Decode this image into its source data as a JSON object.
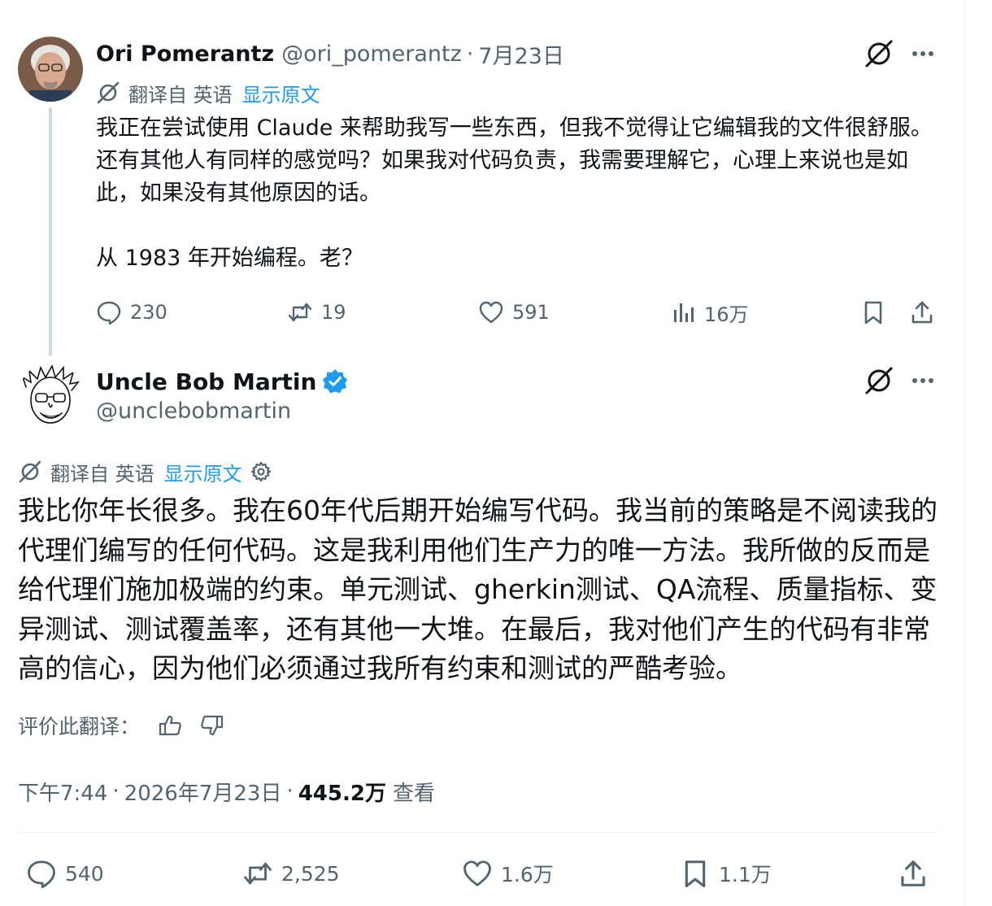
{
  "reply": {
    "author_name": "Ori Pomerantz",
    "handle": "@ori_pomerantz",
    "separator": "·",
    "date": "7月23日",
    "translation": {
      "label": "翻译自 英语",
      "show_original": "显示原文"
    },
    "text": "我正在尝试使用 Claude 来帮助我写一些东西，但我不觉得让它编辑我的文件很舒服。还有其他人有同样的感觉吗？如果我对代码负责，我需要理解它，心理上来说也是如此，如果没有其他原因的话。\n\n从 1983 年开始编程。老？",
    "stats": {
      "replies": "230",
      "reposts": "19",
      "likes": "591",
      "views": "16万"
    }
  },
  "main": {
    "author_name": "Uncle Bob Martin",
    "handle": "@unclebobmartin",
    "translation": {
      "label": "翻译自 英语",
      "show_original": "显示原文"
    },
    "text": "我比你年长很多。我在60年代后期开始编写代码。我当前的策略是不阅读我的代理们编写的任何代码。这是我利用他们生产力的唯一方法。我所做的反而是给代理们施加极端的约束。单元测试、gherkin测试、QA流程、质量指标、变异测试、测试覆盖率，还有其他一大堆。在最后，我对他们产生的代码有非常高的信心，因为他们必须通过我所有约束和测试的严酷考验。",
    "rate_label": "评价此翻译：",
    "time": "下午7:44",
    "separator": "·",
    "date": "2026年7月23日",
    "views_count": "445.2万",
    "views_label": "查看",
    "stats": {
      "replies": "540",
      "reposts": "2,525",
      "likes": "1.6万",
      "bookmarks": "1.1万"
    }
  },
  "colors": {
    "accent": "#1d9bf0",
    "text": "#0f1419",
    "secondary": "#536471",
    "thread_line": "#cfd9de"
  }
}
